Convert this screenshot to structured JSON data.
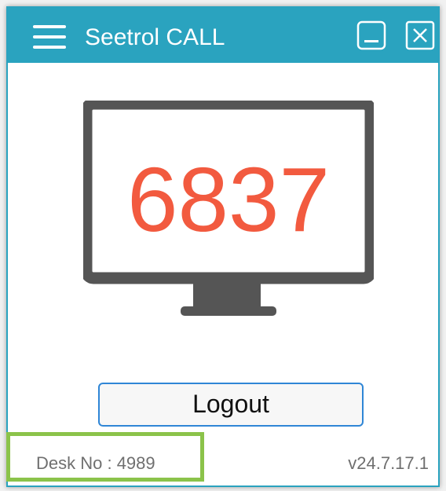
{
  "window": {
    "title": "Seetrol CALL",
    "menu_icon": "hamburger-menu-icon",
    "minimize_icon": "minimize-icon",
    "close_icon": "close-icon"
  },
  "main": {
    "connection_code": "6837",
    "monitor_icon": "monitor-icon",
    "logout_label": "Logout"
  },
  "footer": {
    "desk_no": "Desk No : 4989",
    "version": "v24.7.17.1"
  },
  "colors": {
    "titlebar": "#2aa3bf",
    "code": "#f25a3f",
    "monitor": "#555555",
    "logout_border": "#2f86d6",
    "highlight": "#8bc34a"
  }
}
